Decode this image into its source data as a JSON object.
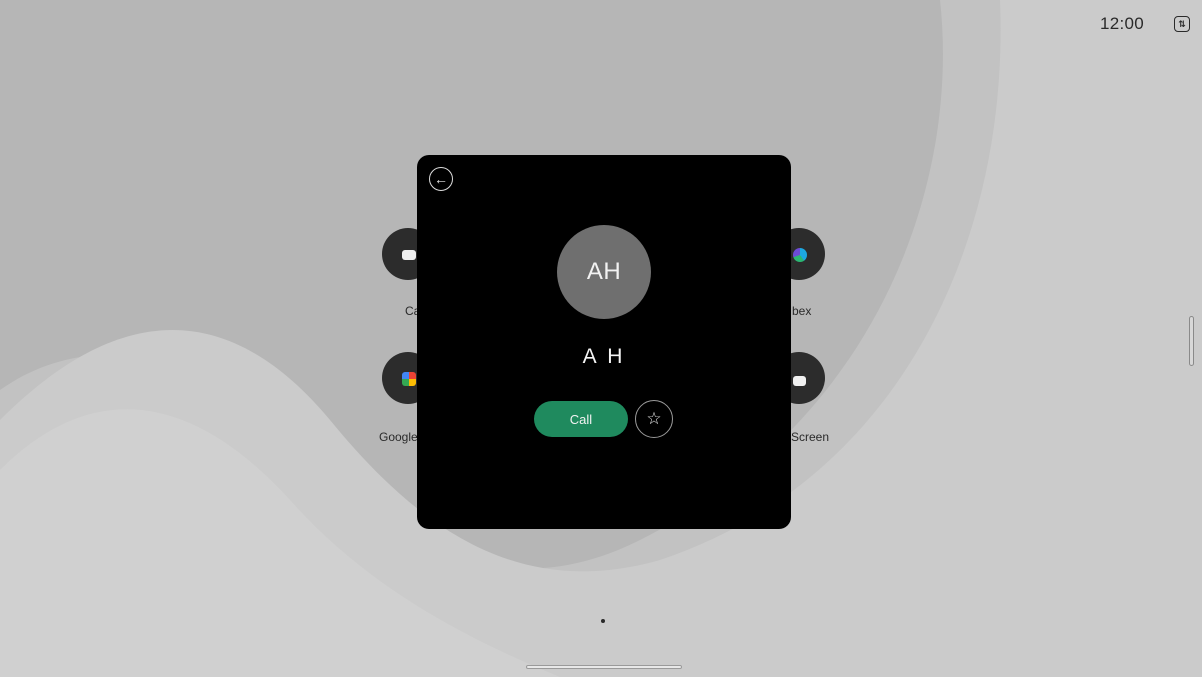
{
  "status_bar": {
    "time": "12:00",
    "sync_icon": "sync-icon"
  },
  "apps": [
    {
      "label": "Ca",
      "icon": "call-app-icon"
    },
    {
      "label": "Google",
      "icon": "google-meet-icon"
    },
    {
      "label": "bex",
      "icon": "webex-icon"
    },
    {
      "label": "Screen",
      "icon": "share-screen-icon"
    }
  ],
  "contact_card": {
    "back_icon": "back-arrow-icon",
    "avatar_initials": "AH",
    "name": "A H",
    "call_label": "Call",
    "favorite_icon": "star-icon",
    "accent_color": "#1f8a5e"
  }
}
